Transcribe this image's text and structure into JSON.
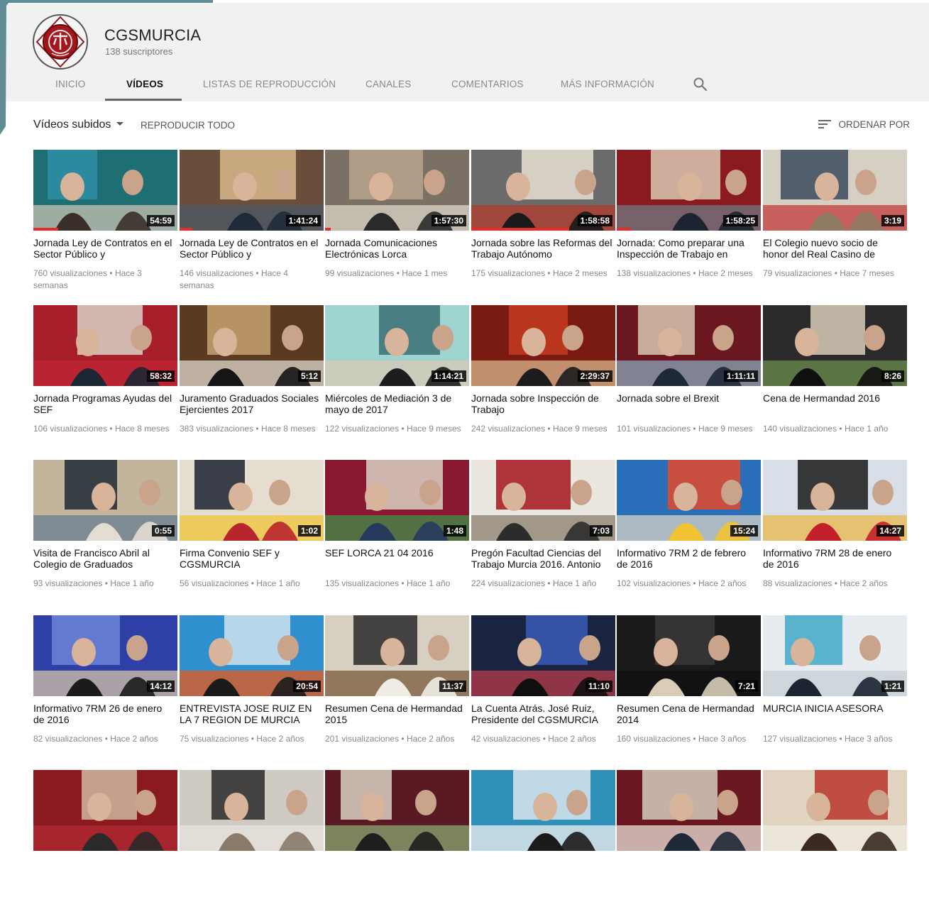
{
  "channel": {
    "name": "CGSMURCIA",
    "subscribers": "138 suscriptores"
  },
  "tabs": [
    {
      "label": "INICIO"
    },
    {
      "label": "VÍDEOS"
    },
    {
      "label": "LISTAS DE REPRODUCCIÓN"
    },
    {
      "label": "CANALES"
    },
    {
      "label": "COMENTARIOS"
    },
    {
      "label": "MÁS INFORMACIÓN"
    }
  ],
  "active_tab": "VÍDEOS",
  "toolbar": {
    "uploads_label": "Vídeos subidos",
    "play_all": "REPRODUCIR TODO",
    "sort_label": "ORDENAR POR"
  },
  "colors": {
    "header_bg": "#f1f1f1",
    "accent": "#e52d27",
    "corner": "#5f8c96"
  },
  "videos": [
    {
      "title": "Jornada Ley de Contratos en el Sector Público y",
      "duration": "54:59",
      "views": "760 visualizaciones",
      "age": "Hace 3 semanas",
      "palette": [
        "#1d6f74",
        "#2e8fa5",
        "#3a2f2a",
        "#c9c0b0"
      ],
      "watched": 0.17
    },
    {
      "title": "Jornada Ley de Contratos en el Sector Público y",
      "duration": "1:41:24",
      "views": "146 visualizaciones",
      "age": "Hace 4 semanas",
      "palette": [
        "#6a4e3c",
        "#d8b98a",
        "#1f2a38",
        "#4b5a66"
      ],
      "watched": 0.09
    },
    {
      "title": "Jornada Comunicaciones Electrónicas Lorca",
      "duration": "1:57:30",
      "views": "99 visualizaciones",
      "age": "Hace 1 mes",
      "palette": [
        "#7a7065",
        "#b8a58e",
        "#2a2a2a",
        "#ded6c8"
      ],
      "watched": 0.04
    },
    {
      "title": "Jornada sobre las Reformas del Trabajo Autónomo",
      "duration": "1:58:58",
      "views": "175 visualizaciones",
      "age": "Hace 2 meses",
      "palette": [
        "#6b6b6b",
        "#e8e0d4",
        "#1a1a1a",
        "#b33a2a"
      ],
      "watched": 0.68
    },
    {
      "title": "Jornada: Como preparar una Inspección de Trabajo en",
      "duration": "1:58:25",
      "views": "138 visualizaciones",
      "age": "Hace 2 meses",
      "palette": [
        "#8a1a20",
        "#d9c8b4",
        "#1b2430",
        "#6f7a84"
      ],
      "watched": 0.1
    },
    {
      "title": "El Colegio nuevo socio de honor del Real Casino de",
      "duration": "3:19",
      "views": "79 visualizaciones",
      "age": "Hace 7 meses",
      "palette": [
        "#d6cfc4",
        "#3b4a5c",
        "#8d7a63",
        "#c23a3a"
      ],
      "watched": 0.0
    },
    {
      "title": "Jornada Programas Ayudas del SEF",
      "duration": "58:32",
      "views": "106 visualizaciones",
      "age": "Hace 8 meses",
      "palette": [
        "#a81f2c",
        "#d8d2c8",
        "#1d2733",
        "#c02633"
      ],
      "watched": 0.0
    },
    {
      "title": "Juramento Graduados Sociales Ejercientes 2017",
      "duration": "5:12",
      "views": "383 visualizaciones",
      "age": "Hace 8 meses",
      "palette": [
        "#5a3b22",
        "#c8a26d",
        "#151515",
        "#e0d9cc"
      ],
      "watched": 0.0
    },
    {
      "title": "Miércoles de Mediación 3 de mayo de 2017",
      "duration": "1:14:21",
      "views": "122 visualizaciones",
      "age": "Hace 9 meses",
      "palette": [
        "#9ed3cf",
        "#3a6f76",
        "#1d1d1d",
        "#d9c9b5"
      ],
      "watched": 0.0
    },
    {
      "title": "Jornada sobre Inspección de Trabajo",
      "duration": "2:29:37",
      "views": "242 visualizaciones",
      "age": "Hace 9 meses",
      "palette": [
        "#7a1b12",
        "#c63a21",
        "#1c1c1c",
        "#d9b58e"
      ],
      "watched": 0.0
    },
    {
      "title": "Jornada sobre el Brexit",
      "duration": "1:11:11",
      "views": "101 visualizaciones",
      "age": "Hace 9 meses",
      "palette": [
        "#6b1720",
        "#d8c7b0",
        "#1e2836",
        "#8aa8b8"
      ],
      "watched": 0.0
    },
    {
      "title": "Cena de Hermandad 2016",
      "duration": "8:26",
      "views": "140 visualizaciones",
      "age": "Hace 1 año",
      "palette": [
        "#2b2b2b",
        "#d9cdb8",
        "#0f0f0f",
        "#6b8e4e"
      ],
      "watched": 0.0
    },
    {
      "title": "Visita de Francisco Abril al Colegio de Graduados",
      "duration": "0:55",
      "views": "93 visualizaciones",
      "age": "Hace 1 año",
      "palette": [
        "#c2b59c",
        "#1f2a36",
        "#e2ddd2",
        "#6a7f92"
      ],
      "watched": 0.0
    },
    {
      "title": "Firma Convenio SEF y CGSMURCIA",
      "duration": "1:02",
      "views": "56 visualizaciones",
      "age": "Hace 1 año",
      "palette": [
        "#e4ddd0",
        "#1b2230",
        "#b7262e",
        "#f0c43a"
      ],
      "watched": 0.0
    },
    {
      "title": "SEF LORCA 21 04 2016",
      "duration": "1:48",
      "views": "135 visualizaciones",
      "age": "Hace 1 año",
      "palette": [
        "#8a1830",
        "#d9d1c3",
        "#263a5c",
        "#3f8f4a"
      ],
      "watched": 0.0
    },
    {
      "title": "Pregón Facultad Ciencias del Trabajo Murcia 2016. Antonio",
      "duration": "7:03",
      "views": "224 visualizaciones",
      "age": "Hace 1 año",
      "palette": [
        "#ebe7df",
        "#a3141d",
        "#2c2c2c",
        "#8a7d6d"
      ],
      "watched": 0.0
    },
    {
      "title": "Informativo 7RM 2 de febrero de 2016",
      "duration": "15:24",
      "views": "102 visualizaciones",
      "age": "Hace 2 años",
      "palette": [
        "#2a6db8",
        "#e44a2a",
        "#f1c232",
        "#d9d3c7"
      ],
      "watched": 0.0
    },
    {
      "title": "Informativo 7RM 28 de enero de 2016",
      "duration": "14:27",
      "views": "88 visualizaciones",
      "age": "Hace 2 años",
      "palette": [
        "#d8dfe8",
        "#1b1b1b",
        "#c2202a",
        "#e8b84a"
      ],
      "watched": 0.0
    },
    {
      "title": "Informativo 7RM 26 de enero de 2016",
      "duration": "14:12",
      "views": "82 visualizaciones",
      "age": "Hace 2 años",
      "palette": [
        "#2f3fa8",
        "#6b86d8",
        "#1b1b1b",
        "#d6c3a8"
      ],
      "watched": 0.0
    },
    {
      "title": "ENTREVISTA JOSE RUIZ EN LA 7 REGION DE MURCIA",
      "duration": "20:54",
      "views": "75 visualizaciones",
      "age": "Hace 2 años",
      "palette": [
        "#2f8fcf",
        "#cfe3ef",
        "#1b1b1b",
        "#e85a1a"
      ],
      "watched": 0.0
    },
    {
      "title": "Resumen Cena de Hermandad 2015",
      "duration": "11:37",
      "views": "201 visualizaciones",
      "age": "Hace 2 años",
      "palette": [
        "#d6cfc2",
        "#2a2a2a",
        "#f1ede6",
        "#7a5a3a"
      ],
      "watched": 0.0
    },
    {
      "title": "La Cuenta Atrás. José Ruiz, Presidente del CGSMURCIA",
      "duration": "11:10",
      "views": "42 visualizaciones",
      "age": "Hace 2 años",
      "palette": [
        "#1a2440",
        "#3a5ab8",
        "#0f0f0f",
        "#b83a4a"
      ],
      "watched": 0.0
    },
    {
      "title": "Resumen Cena de Hermandad 2014",
      "duration": "7:21",
      "views": "160 visualizaciones",
      "age": "Hace 3 años",
      "palette": [
        "#1a1a1a",
        "#3a3a3a",
        "#d9cdb8",
        "#101010"
      ],
      "watched": 0.0
    },
    {
      "title": "MURCIA INICIA ASESORA",
      "duration": "1:21",
      "views": "127 visualizaciones",
      "age": "Hace 3 años",
      "palette": [
        "#e6ecef",
        "#3fa8c8",
        "#1b2430",
        "#c5ced4"
      ],
      "watched": 0.0
    },
    {
      "title": "",
      "duration": "",
      "views": "",
      "age": "",
      "palette": [
        "#8a1a20",
        "#d0b8a0",
        "#2a2a2a",
        "#b02a30"
      ],
      "watched": 0.0
    },
    {
      "title": "",
      "duration": "",
      "views": "",
      "age": "",
      "palette": [
        "#d0cbc2",
        "#2a2a2a",
        "#8a7a6a",
        "#e8e4de"
      ],
      "watched": 0.0
    },
    {
      "title": "",
      "duration": "",
      "views": "",
      "age": "",
      "palette": [
        "#5a1a24",
        "#d9d1c3",
        "#1e1e1e",
        "#8aa870"
      ],
      "watched": 0.0
    },
    {
      "title": "",
      "duration": "",
      "views": "",
      "age": "",
      "palette": [
        "#2e8fb8",
        "#d8e6ee",
        "#1b1b1b",
        "#f0f0f0"
      ],
      "watched": 0.0
    },
    {
      "title": "",
      "duration": "",
      "views": "",
      "age": "",
      "palette": [
        "#6b1720",
        "#d6cdbf",
        "#1e2836",
        "#e8e2d8"
      ],
      "watched": 0.0
    },
    {
      "title": "",
      "duration": "",
      "views": "",
      "age": "",
      "palette": [
        "#e0d4c0",
        "#b8342a",
        "#3a2a20",
        "#f0ebe2"
      ],
      "watched": 0.0
    }
  ]
}
